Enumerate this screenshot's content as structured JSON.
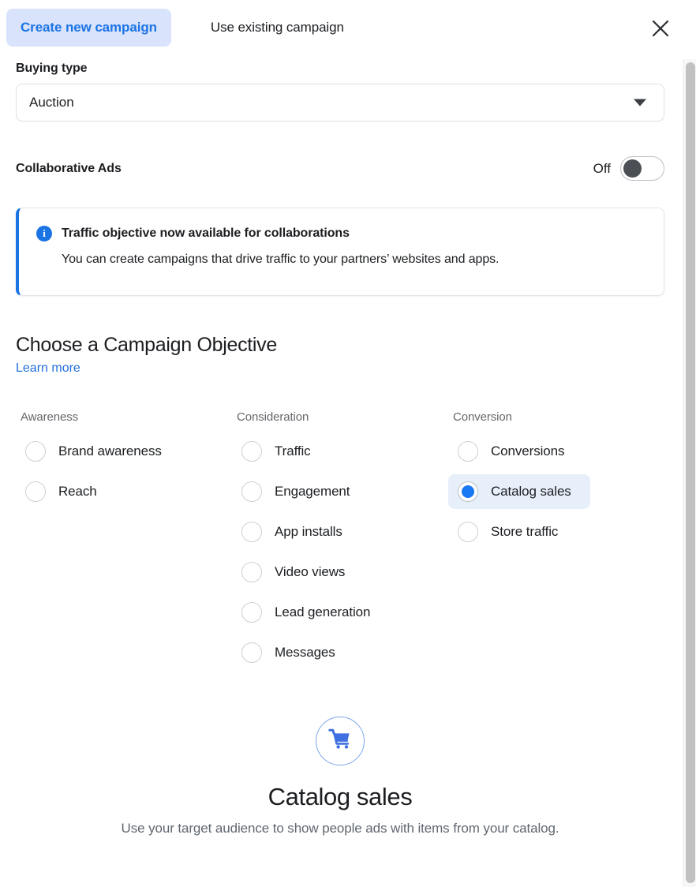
{
  "tabs": [
    {
      "label": "Create new campaign",
      "active": true
    },
    {
      "label": "Use existing campaign",
      "active": false
    }
  ],
  "close_label": "Close",
  "buying_type": {
    "label": "Buying type",
    "value": "Auction"
  },
  "collaborative_ads": {
    "label": "Collaborative Ads",
    "state_label": "Off",
    "enabled": false
  },
  "info_card": {
    "icon": "info-icon",
    "title": "Traffic objective now available for collaborations",
    "body": "You can create campaigns that drive traffic to your partners’ websites and apps.",
    "accent_color": "#1b74e4"
  },
  "objective": {
    "title": "Choose a Campaign Objective",
    "learn_more": "Learn more",
    "columns": [
      {
        "title": "Awareness",
        "options": [
          {
            "label": "Brand awareness",
            "selected": false
          },
          {
            "label": "Reach",
            "selected": false
          }
        ]
      },
      {
        "title": "Consideration",
        "options": [
          {
            "label": "Traffic",
            "selected": false
          },
          {
            "label": "Engagement",
            "selected": false
          },
          {
            "label": "App installs",
            "selected": false
          },
          {
            "label": "Video views",
            "selected": false
          },
          {
            "label": "Lead generation",
            "selected": false
          },
          {
            "label": "Messages",
            "selected": false
          }
        ]
      },
      {
        "title": "Conversion",
        "options": [
          {
            "label": "Conversions",
            "selected": false
          },
          {
            "label": "Catalog sales",
            "selected": true
          },
          {
            "label": "Store traffic",
            "selected": false
          }
        ]
      }
    ]
  },
  "preview": {
    "icon": "shopping-cart-icon",
    "title": "Catalog sales",
    "description": "Use your target audience to show people ads with items from your catalog."
  },
  "colors": {
    "accent": "#1b74e4",
    "tab_active_bg": "#d9e3fb",
    "selected_row_bg": "#e7f0fa",
    "radio_fill": "#1877f2",
    "muted_text": "#65676b"
  }
}
